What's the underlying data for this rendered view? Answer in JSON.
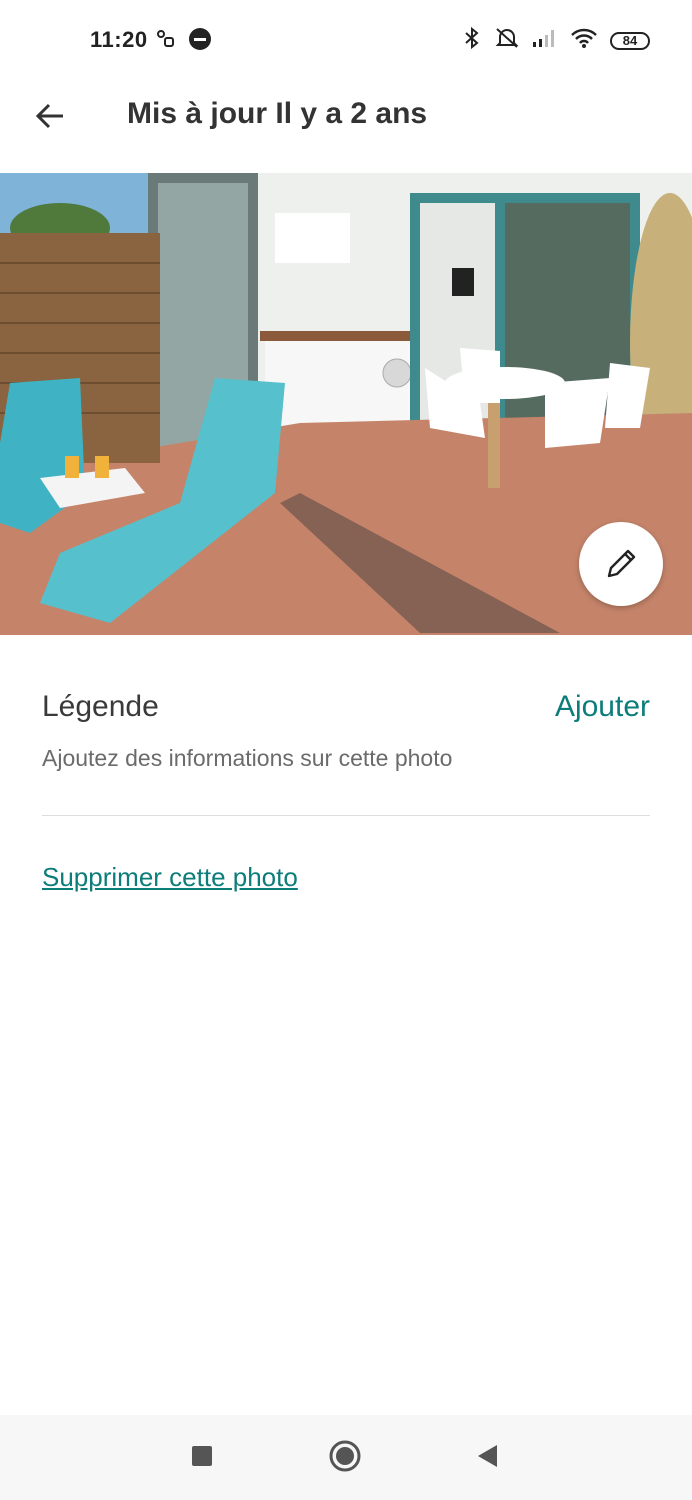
{
  "status_bar": {
    "time": "11:20",
    "left_icons": [
      "link-icon",
      "vpn-icon"
    ],
    "right_icons": [
      "bluetooth-icon",
      "mute-icon",
      "signal-icon",
      "wifi-icon"
    ],
    "battery": "84"
  },
  "header": {
    "back_icon": "arrow-left-icon",
    "title": "Mis à jour Il y a 2 ans"
  },
  "photo": {
    "edit_icon": "pencil-icon"
  },
  "caption": {
    "label": "Légende",
    "add_label": "Ajouter",
    "description": "Ajoutez des informations sur cette photo"
  },
  "actions": {
    "delete_label": "Supprimer cette photo"
  },
  "nav_bar": {
    "buttons": [
      "recents-square-icon",
      "home-circle-icon",
      "back-triangle-icon"
    ]
  },
  "colors": {
    "accent": "#0d7d7a",
    "text_dark": "#333333",
    "text_muted": "#6b6b6b"
  }
}
